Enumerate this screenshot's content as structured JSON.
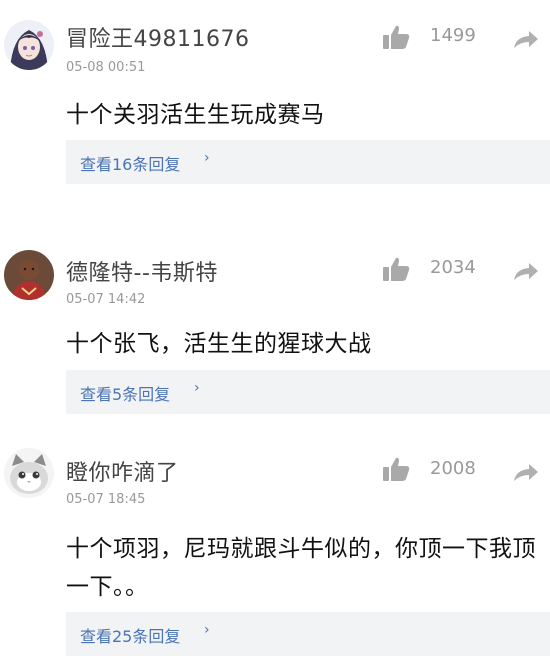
{
  "comments": [
    {
      "username": "冒险王49811676",
      "time": "05-08 00:51",
      "likes": "1499",
      "content": "十个关羽活生生玩成赛马",
      "replies": "查看16条回复",
      "avatar_icon": "anime-girl-avatar"
    },
    {
      "username": "德隆特--韦斯特",
      "time": "05-07 14:42",
      "likes": "2034",
      "content": "十个张飞，活生生的猩球大战",
      "replies": "查看5条回复",
      "avatar_icon": "basketball-player-avatar"
    },
    {
      "username": "瞪你咋滴了",
      "time": "05-07 18:45",
      "likes": "2008",
      "content": "十个项羽，尼玛就跟斗牛似的，你顶一下我顶一下。。",
      "replies": "查看25条回复",
      "avatar_icon": "cat-avatar"
    }
  ],
  "icons": {
    "like": "thumbs-up-icon",
    "share": "share-arrow-icon",
    "chevron": "chevron-right-icon"
  },
  "colors": {
    "reply_link": "#4a74b6",
    "reply_bg": "#f2f3f5",
    "meta_gray": "#999999"
  }
}
